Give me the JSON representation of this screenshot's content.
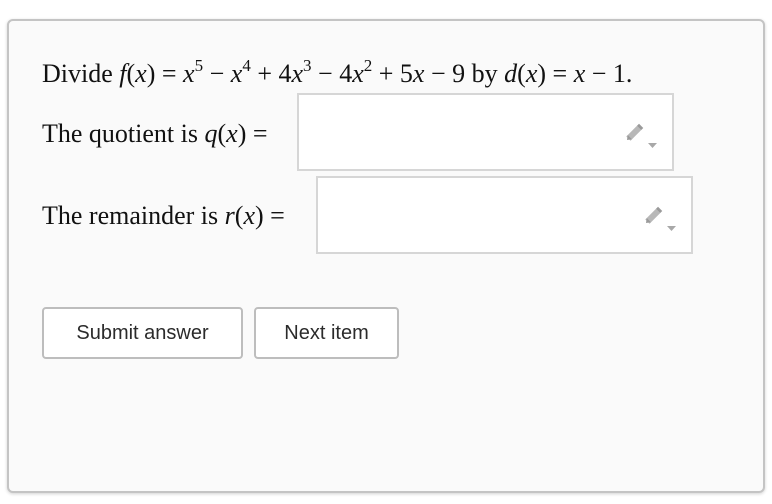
{
  "question": {
    "prefix": "Divide ",
    "f_name": "f",
    "f_args": "(x) = ",
    "f_expr": [
      "x",
      "5",
      " − ",
      "x",
      "4",
      " + 4",
      "x",
      "3",
      " − 4",
      "x",
      "2",
      " + 5",
      "x",
      " − 9"
    ],
    "by": " by ",
    "d_name": "d",
    "d_args": "(x) = ",
    "d_expr": "x − 1."
  },
  "quotient": {
    "label": "The quotient is ",
    "var": "q",
    "args": "(x) = "
  },
  "remainder": {
    "label": "The remainder is ",
    "var": "r",
    "args": "(x) = "
  },
  "buttons": {
    "submit": "Submit answer",
    "next": "Next item"
  },
  "icons": {
    "answer_editor": "pencil-dropdown-icon"
  }
}
